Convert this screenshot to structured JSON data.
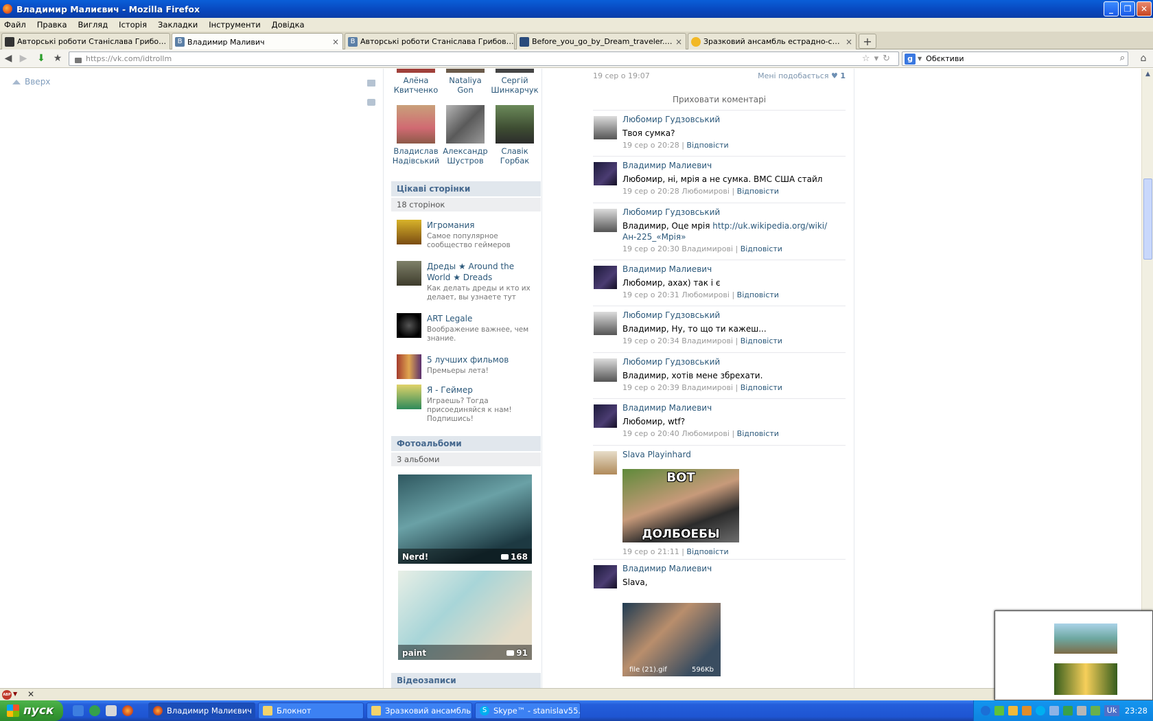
{
  "window": {
    "title": "Владимир Малиєвич - Mozilla Firefox"
  },
  "menu": [
    "Файл",
    "Правка",
    "Вигляд",
    "Історія",
    "Закладки",
    "Інструменти",
    "Довідка"
  ],
  "tabs": [
    {
      "label": "Авторські роботи Станіслава Грибовича",
      "active": false
    },
    {
      "label": "Владимир Маливич",
      "active": true
    },
    {
      "label": "Авторські роботи Станіслава Грибовича",
      "active": false
    },
    {
      "label": "Before_you_go_by_Dream_traveler.jpg ...",
      "active": false
    },
    {
      "label": "Зразковий ансамбль естрадно-спорти...",
      "active": false
    }
  ],
  "nav": {
    "url": "https://vk.com/idtrollm",
    "search_value": "Обєктиви"
  },
  "page": {
    "up_label": "Вверх",
    "friends": [
      {
        "first": "Алёна",
        "last": "Квитченко"
      },
      {
        "first": "Nataliya",
        "last": "Gon"
      },
      {
        "first": "Сергій",
        "last": "Шинкарчук"
      },
      {
        "first": "Владислав",
        "last": "Надівський"
      },
      {
        "first": "Александр",
        "last": "Шустров"
      },
      {
        "first": "Славік",
        "last": "Горбак"
      }
    ],
    "pages_section": {
      "title": "Цікаві сторінки",
      "count": "18 сторінок"
    },
    "pages": [
      {
        "name": "Игромания",
        "desc": "Самое популярное сообщество геймеров"
      },
      {
        "name": "Дреды ★ Around the World ★ Dreads",
        "desc": "Как делать дреды и кто их делает, вы узнаете тут"
      },
      {
        "name": "ART Legale",
        "desc": "Воображение важнее, чем знание."
      },
      {
        "name": "5 лучших фильмов",
        "desc": "Премьеры лета!"
      },
      {
        "name": "Я - Геймер",
        "desc": "Играешь? Тогда присоединяйся к нам! Подпишись!"
      }
    ],
    "albums_section": {
      "title": "Фотоальбоми",
      "count": "3 альбоми"
    },
    "albums": [
      {
        "name": "Nerd!",
        "count": "168"
      },
      {
        "name": "paint",
        "count": "91"
      }
    ],
    "videos_section": {
      "title": "Відеозаписи"
    },
    "wall": {
      "post_date": "19 сер о 19:07",
      "likes_label": "Мені подобається",
      "likes_count": "1",
      "hide_comments": "Приховати коментарі",
      "reply_label": "Відповісти",
      "comments": [
        {
          "author": "Любомир Гудзовський",
          "text": "Твоя сумка?",
          "meta": "19 сер о 20:28"
        },
        {
          "author": "Владимир Малиевич",
          "text": "Любомир, ні, мрія а не сумка. ВМС США стайл",
          "meta": "19 сер о 20:28 Любомирові"
        },
        {
          "author": "Любомир Гудзовський",
          "text": "Владимир, Оце мрія ",
          "link": "http://uk.wikipedia.org/wiki/Ан-225_«Мрія»",
          "meta": "19 сер о 20:30 Владимирові"
        },
        {
          "author": "Владимир Малиевич",
          "text": "Любомир, ахах) так і є",
          "meta": "19 сер о 20:31 Любомирові"
        },
        {
          "author": "Любомир Гудзовський",
          "text": "Владимир, Ну, то що ти кажеш...",
          "meta": "19 сер о 20:34 Владимирові"
        },
        {
          "author": "Любомир Гудзовський",
          "text": "Владимир, хотів мене збрехати.",
          "meta": "19 сер о 20:39 Владимирові"
        },
        {
          "author": "Владимир Малиевич",
          "text": "Любомир, wtf?",
          "meta": "19 сер о 20:40 Любомирові"
        },
        {
          "author": "Slava Playinhard",
          "meme_top": "ВОТ",
          "meme_bottom": "ДОЛБОЕБЫ",
          "meta": "19 сер о 21:11"
        },
        {
          "author": "Владимир Малиевич",
          "text": "Slava,",
          "gif_name": "file (21).gif",
          "gif_size": "596Kb"
        }
      ]
    }
  },
  "taskbar": {
    "start_label": "пуск",
    "buttons": [
      {
        "label": "Владимир Малиєвич ...",
        "active": true
      },
      {
        "label": "Блокнот",
        "active": false
      },
      {
        "label": "Зразковий ансамбль...",
        "active": false
      },
      {
        "label": "Skype™ - stanislav55...",
        "active": false
      }
    ],
    "lang": "Uk",
    "clock": "23:28"
  },
  "colors": {
    "vk_link": "#2b587a",
    "vk_header_bg": "#e1e7ed",
    "xp_title": "#0a5fd8"
  }
}
